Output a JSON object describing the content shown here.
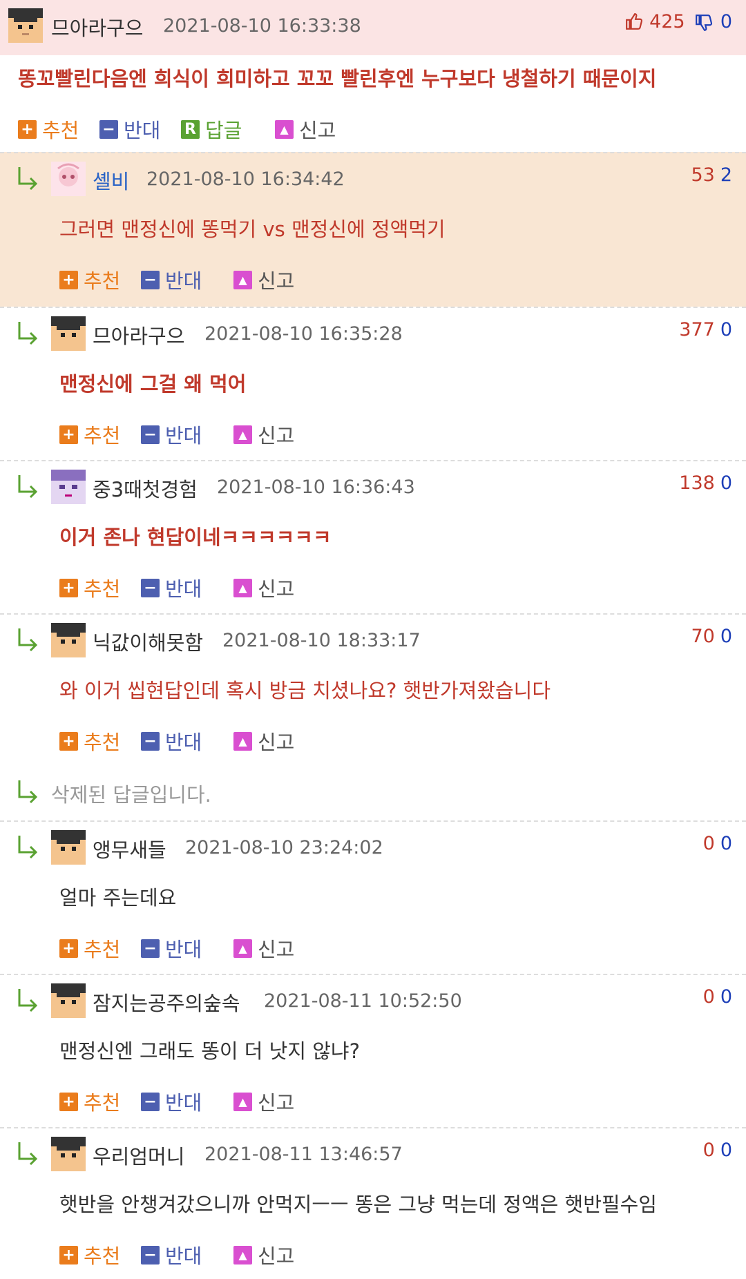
{
  "top_comment": {
    "nickname": "므아라구으",
    "date": "2021-08-10 16:33:38",
    "upvotes": "425",
    "downvotes": "0",
    "body": "똥꼬빨린다음엔 희식이 희미하고 꼬꼬 빨린후엔 누구보다 냉철하기 때문이지",
    "actions": {
      "recommend": "추천",
      "oppose": "반대",
      "reply": "답글",
      "report": "신고"
    }
  },
  "replies": [
    {
      "nickname": "셸비",
      "date": "2021-08-10 16:34:42",
      "up": "53",
      "down": "2",
      "body": "그러면 맨정신에 똥먹기 vs 맨정신에 정액먹기"
    },
    {
      "nickname": "므아라구으",
      "date": "2021-08-10 16:35:28",
      "up": "377",
      "down": "0",
      "body": "맨정신에 그걸 왜 먹어"
    },
    {
      "nickname": "중3때첫경험",
      "date": "2021-08-10 16:36:43",
      "up": "138",
      "down": "0",
      "body": "이거 존나 현답이네ㅋㅋㅋㅋㅋㅋ"
    },
    {
      "nickname": "닉값이해못함",
      "date": "2021-08-10 18:33:17",
      "up": "70",
      "down": "0",
      "body": "와 이거 씹현답인데 혹시 방금 치셨나요? 햇반가져왔습니다"
    },
    {
      "deleted_text": "삭제된 답글입니다."
    },
    {
      "nickname": "앵무새들",
      "date": "2021-08-10 23:24:02",
      "up": "0",
      "down": "0",
      "body": "얼마 주는데요"
    },
    {
      "nickname": "잠지는공주의숲속",
      "date": "2021-08-11 10:52:50",
      "up": "0",
      "down": "0",
      "body": "맨정신엔 그래도 똥이 더 낫지 않냐?"
    },
    {
      "nickname": "우리엄머니",
      "date": "2021-08-11 13:46:57",
      "up": "0",
      "down": "0",
      "body": "햇반을 안챙겨갔으니까 안먹지ㅡㅡ 똥은 그냥 먹는데 정액은 햇반필수임"
    }
  ],
  "reply_actions": {
    "recommend": "추천",
    "oppose": "반대",
    "report": "신고"
  }
}
